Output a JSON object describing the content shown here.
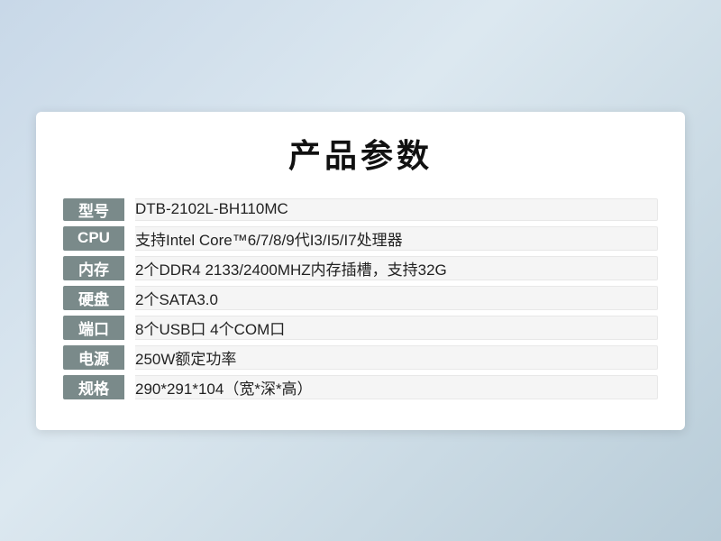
{
  "page": {
    "title": "产品参数",
    "accent_color": "#7a8a8a"
  },
  "specs": [
    {
      "label": "型号",
      "value": "DTB-2102L-BH110MC"
    },
    {
      "label": "CPU",
      "value": "支持Intel Core™6/7/8/9代I3/I5/I7处理器"
    },
    {
      "label": "内存",
      "value": "2个DDR4 2133/2400MHZ内存插槽，支持32G"
    },
    {
      "label": "硬盘",
      "value": "2个SATA3.0"
    },
    {
      "label": "端口",
      "value": "8个USB口 4个COM口"
    },
    {
      "label": "电源",
      "value": "250W额定功率"
    },
    {
      "label": "规格",
      "value": "290*291*104（宽*深*高）"
    }
  ]
}
